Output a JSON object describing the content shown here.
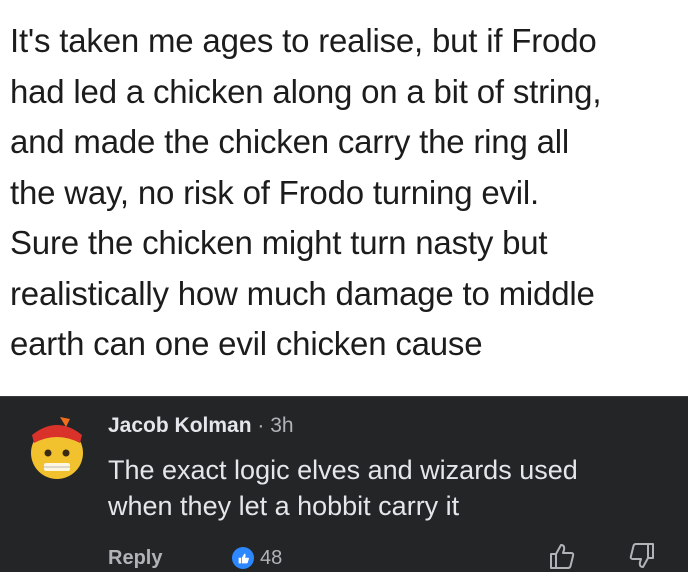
{
  "post": {
    "text_lines": [
      "It's taken me ages to realise, but if Frodo",
      "had led a chicken along on a bit of string,",
      "and made the chicken carry the ring all",
      "the way, no risk of Frodo turning evil.",
      "Sure the chicken might turn nasty but",
      "realistically how much damage to middle",
      "earth can one evil chicken cause"
    ]
  },
  "comment": {
    "author": "Jacob Kolman",
    "separator": " · ",
    "time": "3h",
    "text_lines": [
      "The exact logic elves and wizards used",
      "when they let a hobbit carry it"
    ],
    "reply_label": "Reply",
    "reaction_count": "48",
    "icons": {
      "avatar": "avatar-emoji-icon",
      "reaction": "like-reaction-icon",
      "upvote": "thumb-up-icon",
      "downvote": "thumb-down-icon"
    }
  },
  "colors": {
    "post_bg": "#ffffff",
    "post_text": "#1c1c1c",
    "comment_bg": "#242526",
    "comment_text": "#e4e6eb",
    "muted_text": "#b0b3b8",
    "like_blue": "#2d88ff"
  }
}
